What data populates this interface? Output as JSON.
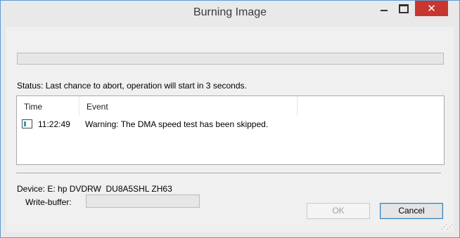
{
  "window": {
    "title": "Burning Image",
    "minimize_icon": "minimize-icon",
    "maximize_icon": "maximize-icon",
    "close_icon": "close-icon",
    "close_color": "#c7372f"
  },
  "progress": {
    "value": 0
  },
  "status": {
    "text": "Status: Last chance to abort, operation will start in 3 seconds."
  },
  "log": {
    "columns": [
      "Time",
      "Event"
    ],
    "rows": [
      {
        "icon": "event-log-icon",
        "time": "11:22:49",
        "event": "Warning: The DMA speed test has been skipped."
      }
    ]
  },
  "device": {
    "text": "Device: E: hp DVDRW  DU8A5SHL ZH63"
  },
  "write_buffer": {
    "label": "Write-buffer:",
    "value": 0
  },
  "buttons": {
    "ok": "OK",
    "cancel": "Cancel"
  }
}
